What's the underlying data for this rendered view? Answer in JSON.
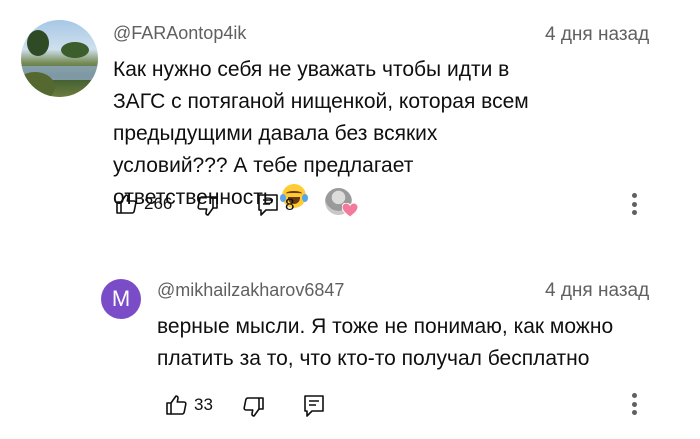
{
  "comments": [
    {
      "handle": "@FARAontop4ik",
      "time": "4 дня назад",
      "text": "Как нужно себя не уважать чтобы идти в ЗАГС с потяганой нищенкой, которая всем предыдущими давала без всяких условий??? А тебе предлагает ответственность",
      "emoji": "face-with-tears-of-joy",
      "likes": "266",
      "replies": "8",
      "avatar": "lake-landscape-photo",
      "creator_heart": true
    },
    {
      "handle": "@mikhailzakharov6847",
      "time": "4 дня назад",
      "text": "верные мысли. Я тоже не понимаю, как можно платить за то, что кто-то получал бесплатно",
      "likes": "33",
      "avatar_letter": "M",
      "avatar_color": "#7b4cc7"
    }
  ],
  "colors": {
    "secondary_text": "#606060",
    "primary_text": "#0f0f0f",
    "heart": "#f27a9c"
  }
}
